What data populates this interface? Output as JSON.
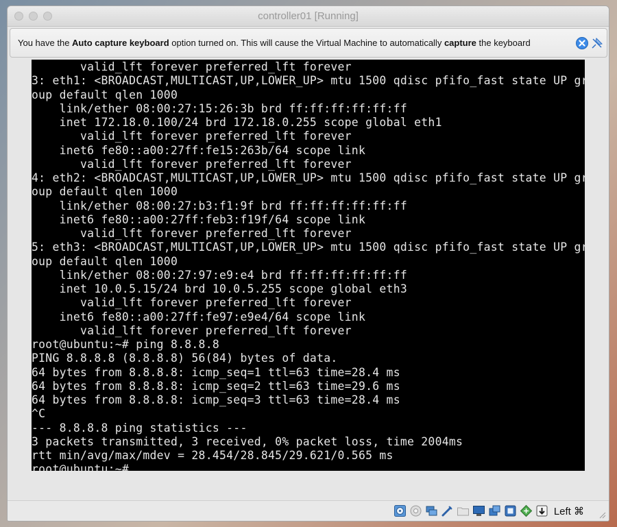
{
  "window": {
    "title": "controller01 [Running]"
  },
  "notice": {
    "segments": [
      {
        "text": "You have the ",
        "bold": false
      },
      {
        "text": "Auto capture keyboard",
        "bold": true
      },
      {
        "text": " option turned on. This will cause the Virtual Machine to automatically ",
        "bold": false
      },
      {
        "text": "capture",
        "bold": true
      },
      {
        "text": " the keyboard",
        "bold": false
      }
    ],
    "icons": [
      "info-close-icon",
      "pin-icon"
    ]
  },
  "terminal": {
    "lines": [
      "       valid_lft forever preferred_lft forever",
      "3: eth1: <BROADCAST,MULTICAST,UP,LOWER_UP> mtu 1500 qdisc pfifo_fast state UP gr",
      "oup default qlen 1000",
      "    link/ether 08:00:27:15:26:3b brd ff:ff:ff:ff:ff:ff",
      "    inet 172.18.0.100/24 brd 172.18.0.255 scope global eth1",
      "       valid_lft forever preferred_lft forever",
      "    inet6 fe80::a00:27ff:fe15:263b/64 scope link",
      "       valid_lft forever preferred_lft forever",
      "4: eth2: <BROADCAST,MULTICAST,UP,LOWER_UP> mtu 1500 qdisc pfifo_fast state UP gr",
      "oup default qlen 1000",
      "    link/ether 08:00:27:b3:f1:9f brd ff:ff:ff:ff:ff:ff",
      "    inet6 fe80::a00:27ff:feb3:f19f/64 scope link",
      "       valid_lft forever preferred_lft forever",
      "5: eth3: <BROADCAST,MULTICAST,UP,LOWER_UP> mtu 1500 qdisc pfifo_fast state UP gr",
      "oup default qlen 1000",
      "    link/ether 08:00:27:97:e9:e4 brd ff:ff:ff:ff:ff:ff",
      "    inet 10.0.5.15/24 brd 10.0.5.255 scope global eth3",
      "       valid_lft forever preferred_lft forever",
      "    inet6 fe80::a00:27ff:fe97:e9e4/64 scope link",
      "       valid_lft forever preferred_lft forever",
      "root@ubuntu:~# ping 8.8.8.8",
      "PING 8.8.8.8 (8.8.8.8) 56(84) bytes of data.",
      "64 bytes from 8.8.8.8: icmp_seq=1 ttl=63 time=28.4 ms",
      "64 bytes from 8.8.8.8: icmp_seq=2 ttl=63 time=29.6 ms",
      "64 bytes from 8.8.8.8: icmp_seq=3 ttl=63 time=28.4 ms",
      "^C",
      "--- 8.8.8.8 ping statistics ---",
      "3 packets transmitted, 3 received, 0% packet loss, time 2004ms",
      "rtt min/avg/max/mdev = 28.454/28.845/29.621/0.565 ms",
      "root@ubuntu:~#"
    ]
  },
  "statusbar": {
    "icons": [
      "optical-drive-icon",
      "audio-icon",
      "network-icon",
      "usb-icon",
      "shared-folder-icon",
      "display-icon",
      "video-capture-icon",
      "vt-x-icon",
      "mouse-integration-icon",
      "keyboard-capture-icon"
    ],
    "host_key": "Left ⌘"
  }
}
